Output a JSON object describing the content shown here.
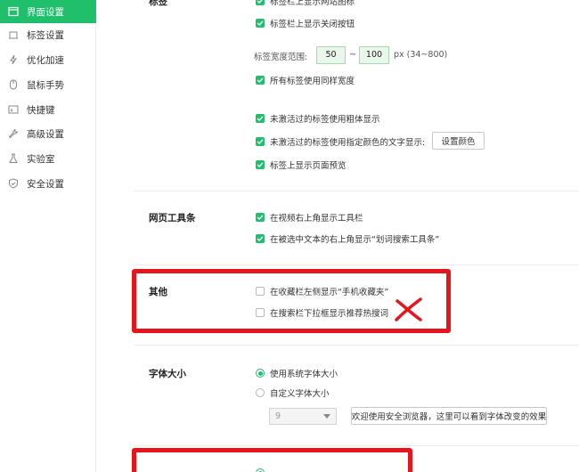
{
  "sidebar": {
    "items": [
      {
        "label": "界面设置",
        "icon": "window-icon",
        "active": true
      },
      {
        "label": "标签设置",
        "icon": "tab-icon",
        "active": false
      },
      {
        "label": "优化加速",
        "icon": "bolt-icon",
        "active": false
      },
      {
        "label": "鼠标手势",
        "icon": "mouse-icon",
        "active": false
      },
      {
        "label": "快捷键",
        "icon": "keyboard-icon",
        "active": false
      },
      {
        "label": "高级设置",
        "icon": "wrench-icon",
        "active": false
      },
      {
        "label": "实验室",
        "icon": "flask-icon",
        "active": false
      },
      {
        "label": "安全设置",
        "icon": "shield-icon",
        "active": false
      }
    ]
  },
  "tabs_section": {
    "title": "标签",
    "opt_site_icon": "标签栏上显示网站图标",
    "opt_close_button": "标签栏上显示关闭按钮",
    "width_range_label": "标签宽度范围:",
    "width_min": "50",
    "width_sep": "~",
    "width_max": "100",
    "width_unit": "px  (34~800)",
    "opt_same_width": "所有标签使用同样宽度",
    "opt_bold_inactive": "未激活过的标签使用粗体显示",
    "opt_color_inactive": "未激活过的标签使用指定颜色的文字显示:",
    "set_color_button": "设置颜色",
    "opt_preview": "标签上显示页面预览"
  },
  "toolbar_section": {
    "title": "网页工具条",
    "opt_video_toolbar": "在视频右上角显示工具栏",
    "opt_selection_search": "在被选中文本的右上角显示“划词搜索工具条”"
  },
  "other_section": {
    "title": "其他",
    "opt_mobile_fav": "在收藏栏左侧显示“手机收藏夹”",
    "opt_hot_search": "在搜索栏下拉框显示推荐热搜词"
  },
  "font_section": {
    "title": "字体大小",
    "opt_system_font": "使用系统字体大小",
    "opt_custom_font": "自定义字体大小",
    "font_size_value": "9",
    "preview_text": "欢迎使用安全浏览器，这里可以看到字体改变的效果"
  },
  "colors": {
    "accent": "#1fbf6c",
    "annotation_red": "#e8141c"
  }
}
